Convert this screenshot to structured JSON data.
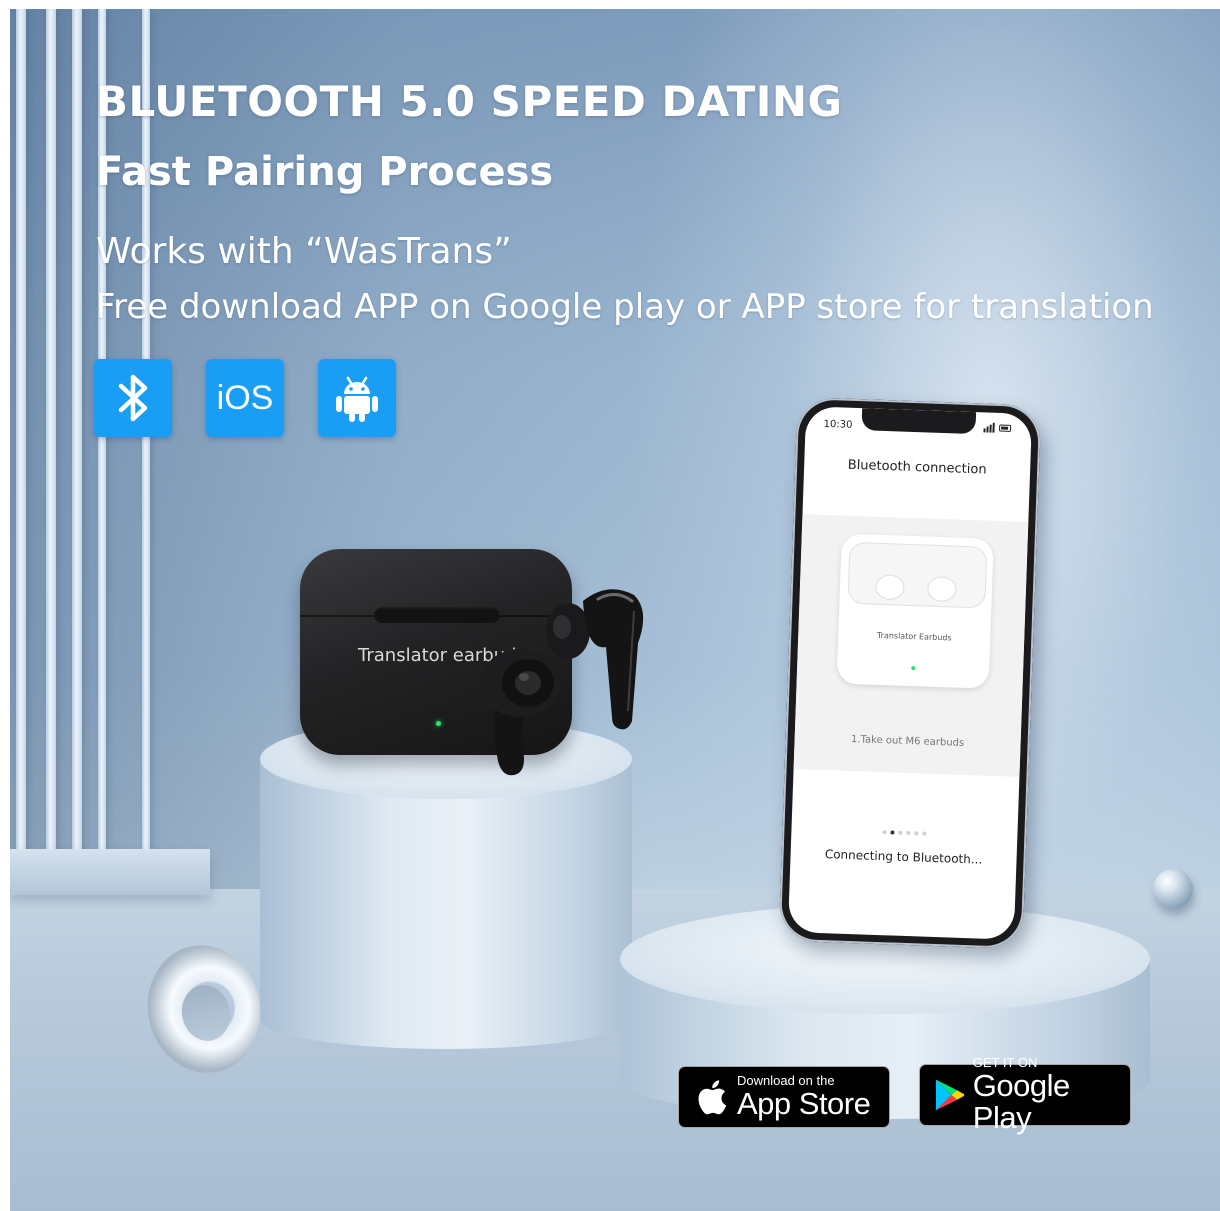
{
  "headline": "BLUETOOTH 5.0 SPEED DATING",
  "subheadline": "Fast Pairing Process",
  "app_line": "Works with “WasTrans”",
  "download_line": "Free download APP on Google play or APP store for translation",
  "badges": {
    "ios_label": "iOS"
  },
  "case_label": "Translator earbuds",
  "phone": {
    "time": "10:30",
    "title": "Bluetooth connection",
    "mini_case_label": "Translator Earbuds",
    "step": "1.Take out M6 earbuds",
    "status": "Connecting to Bluetooth...",
    "page_count": 6,
    "active_page": 2
  },
  "app_store": {
    "small": "Download on the",
    "big": "App Store"
  },
  "google_play": {
    "small": "GET IT ON",
    "big": "Google Play"
  },
  "colors": {
    "badge_blue": "#1a9ef5",
    "led_green": "#2ee36a"
  }
}
